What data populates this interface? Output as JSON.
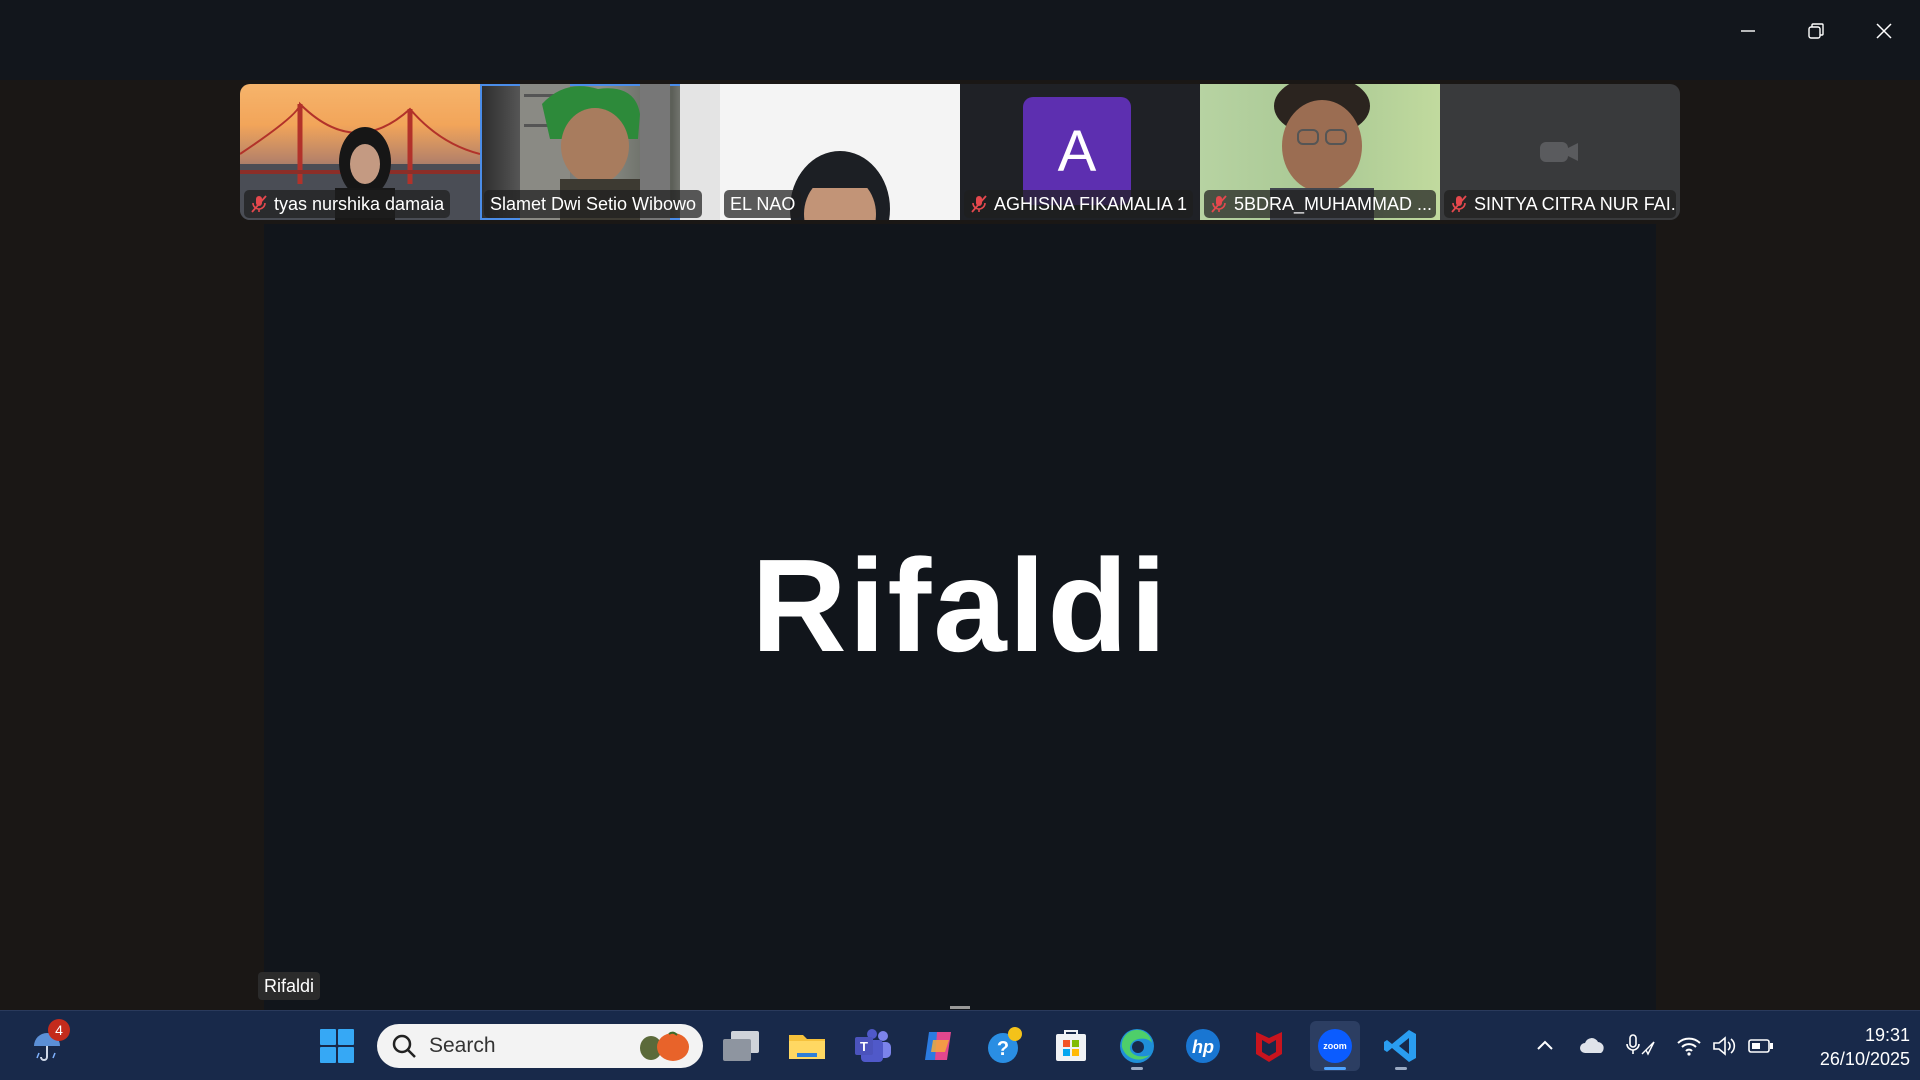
{
  "window": {
    "controls": [
      "minimize-icon",
      "restore-icon",
      "close-icon"
    ]
  },
  "participants": [
    {
      "name": "tyas nurshika damaia",
      "muted": true,
      "video": "bridge-background"
    },
    {
      "name": "Slamet Dwi Setio Wibowo",
      "muted": false,
      "video": "room-background",
      "active": true
    },
    {
      "name": "EL NAO",
      "muted": false,
      "video": "white-background"
    },
    {
      "name": "AGHISNA FIKAMALIA 1",
      "muted": true,
      "avatar_letter": "A",
      "avatar_color": "#5d2fb0"
    },
    {
      "name": "5BDRA_MUHAMMAD ...",
      "muted": true,
      "video": "green-background"
    },
    {
      "name": "SINTYA CITRA NUR FAI...",
      "muted": true,
      "video": "camera-off"
    }
  ],
  "main_speaker": {
    "display_name": "Rifaldi",
    "tag": "Rifaldi"
  },
  "taskbar": {
    "weather_badge": "4",
    "search_placeholder": "Search",
    "apps": [
      "start-icon",
      "task-view-icon",
      "file-explorer-icon",
      "teams-icon",
      "copilot-icon",
      "get-help-icon",
      "microsoft-store-icon",
      "edge-icon",
      "hp-icon",
      "mcafee-icon",
      "zoom-icon",
      "vscode-icon"
    ],
    "tray": [
      "chevron-up-icon",
      "onedrive-icon",
      "microphone-icon",
      "wifi-icon",
      "volume-icon",
      "battery-icon"
    ],
    "time": "19:31",
    "date": "26/10/2025"
  },
  "colors": {
    "accent": "#4b8de8",
    "mic_off": "#e5484d",
    "zoom_blue": "#0b5cff",
    "taskbar": "#18294a"
  }
}
